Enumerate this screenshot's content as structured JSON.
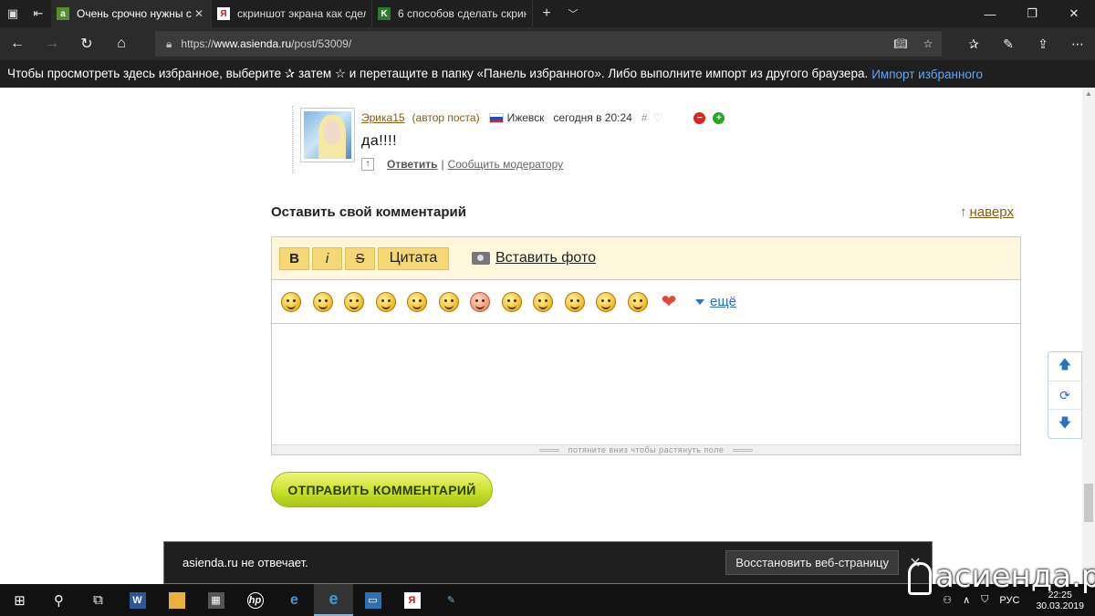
{
  "browser": {
    "tabs": [
      {
        "title": "Очень срочно нужны с",
        "active": true
      },
      {
        "title": "скриншот экрана как сдел",
        "active": false
      },
      {
        "title": "6 способов сделать скрин",
        "active": false
      }
    ],
    "url_prefix": "https://",
    "url_host": "www.asienda.ru",
    "url_path": "/post/53009/",
    "favorites_bar_text": "Чтобы просмотреть здесь избранное, выберите  ✰  затем ☆ и перетащите в папку «Панель избранного». Либо выполните импорт из другого браузера.",
    "favorites_import_link": "Импорт избранного"
  },
  "comment": {
    "username": "Эрика15",
    "author_tag": "(автор поста)",
    "city": "Ижевск",
    "time": "сегодня в 20:24",
    "hash": "#",
    "text": "да!!!!",
    "reply_label": "Ответить",
    "separator": "|",
    "report_label": "Сообщить модератору"
  },
  "comment_form": {
    "title": "Оставить свой комментарий",
    "to_top_arrow": "↑",
    "to_top_label": "наверх",
    "toolbar": {
      "bold": "B",
      "italic": "i",
      "strike": "S",
      "quote": "Цитата",
      "insert_photo": "Вставить фото"
    },
    "more_smiles": "ещё",
    "resize_hint": "потяните вниз чтобы растянуть поле",
    "textarea_value": "",
    "submit_label": "ОТПРАВИТЬ КОММЕНТАРИЙ"
  },
  "notification": {
    "message": "asienda.ru не отвечает.",
    "action": "Восстановить веб-страницу"
  },
  "taskbar": {
    "language": "РУС",
    "time": "22:25",
    "date": "30.03.2019"
  },
  "watermark": "асиенда.ру",
  "colors": {
    "link_brown": "#8a5a14",
    "toolbar_bg": "#fff6dc",
    "button_yellow": "#f6d776",
    "submit_green": "#c9e02b",
    "link_blue": "#2a6fc9"
  }
}
